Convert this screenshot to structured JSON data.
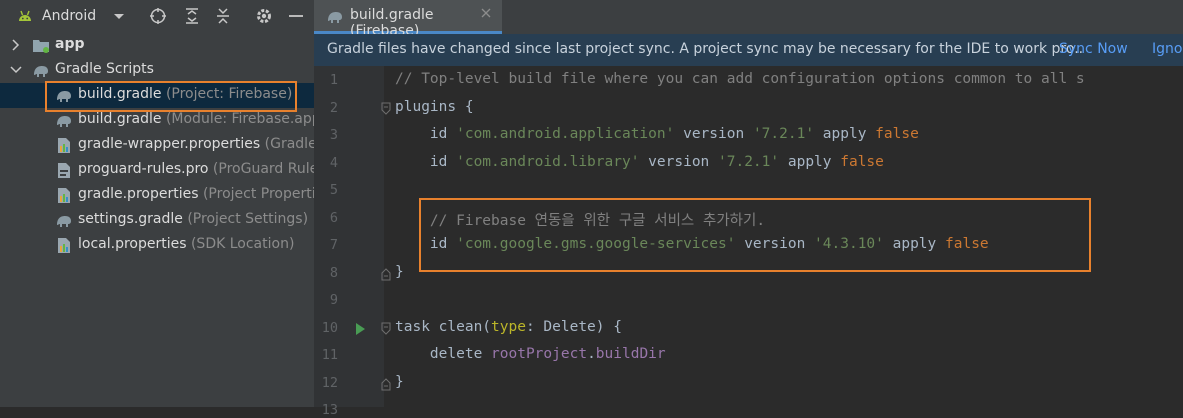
{
  "sidebar": {
    "title": "Android",
    "tree": [
      {
        "label": "app",
        "sub": ""
      },
      {
        "label": "Gradle Scripts",
        "sub": ""
      },
      {
        "label": "build.gradle",
        "sub": " (Project: Firebase)"
      },
      {
        "label": "build.gradle",
        "sub": " (Module: Firebase.app"
      },
      {
        "label": "gradle-wrapper.properties",
        "sub": " (Gradle V"
      },
      {
        "label": "proguard-rules.pro",
        "sub": " (ProGuard Rule"
      },
      {
        "label": "gradle.properties",
        "sub": " (Project Propertie"
      },
      {
        "label": "settings.gradle",
        "sub": " (Project Settings)"
      },
      {
        "label": "local.properties",
        "sub": " (SDK Location)"
      }
    ]
  },
  "editor": {
    "tab_label": "build.gradle (Firebase)",
    "notification": {
      "message": "Gradle files have changed since last project sync. A project sync may be necessary for the IDE to work pro..",
      "sync_now": "Sync Now",
      "ignore": "Igno"
    },
    "colors": {
      "comment": "#808080",
      "string": "#6a8759",
      "keyword": "#cc7832",
      "highlight": "#e8812d"
    },
    "lines": [
      {
        "n": "1",
        "t": [
          {
            "c": "comment",
            "s": "// Top-level build file where you can add configuration options common to all s"
          }
        ]
      },
      {
        "n": "2",
        "t": [
          {
            "c": "plain",
            "s": "plugins {"
          }
        ]
      },
      {
        "n": "3",
        "t": [
          {
            "c": "plain",
            "s": "    id "
          },
          {
            "c": "str",
            "s": "'com.android.application'"
          },
          {
            "c": "plain",
            "s": " version "
          },
          {
            "c": "str",
            "s": "'7.2.1'"
          },
          {
            "c": "plain",
            "s": " apply "
          },
          {
            "c": "kw",
            "s": "false"
          }
        ]
      },
      {
        "n": "4",
        "t": [
          {
            "c": "plain",
            "s": "    id "
          },
          {
            "c": "str",
            "s": "'com.android.library'"
          },
          {
            "c": "plain",
            "s": " version "
          },
          {
            "c": "str",
            "s": "'7.2.1'"
          },
          {
            "c": "plain",
            "s": " apply "
          },
          {
            "c": "kw",
            "s": "false"
          }
        ]
      },
      {
        "n": "5",
        "t": []
      },
      {
        "n": "6",
        "t": [
          {
            "c": "comment",
            "s": "    // Firebase 연동을 위한 구글 서비스 추가하기."
          }
        ]
      },
      {
        "n": "7",
        "t": [
          {
            "c": "plain",
            "s": "    id "
          },
          {
            "c": "str",
            "s": "'com.google.gms.google-services'"
          },
          {
            "c": "plain",
            "s": " version "
          },
          {
            "c": "str",
            "s": "'4.3.10'"
          },
          {
            "c": "plain",
            "s": " apply "
          },
          {
            "c": "kw",
            "s": "false"
          }
        ]
      },
      {
        "n": "8",
        "t": [
          {
            "c": "plain",
            "s": "}"
          }
        ]
      },
      {
        "n": "9",
        "t": []
      },
      {
        "n": "10",
        "t": [
          {
            "c": "plain",
            "s": "task clean("
          },
          {
            "c": "param",
            "s": "type"
          },
          {
            "c": "plain",
            "s": ": Delete) {"
          }
        ]
      },
      {
        "n": "11",
        "t": [
          {
            "c": "plain",
            "s": "    delete "
          },
          {
            "c": "prop",
            "s": "rootProject"
          },
          {
            "c": "plain",
            "s": "."
          },
          {
            "c": "prop",
            "s": "buildDir"
          }
        ]
      },
      {
        "n": "12",
        "t": [
          {
            "c": "plain",
            "s": "}"
          }
        ]
      },
      {
        "n": "13",
        "t": []
      }
    ]
  }
}
